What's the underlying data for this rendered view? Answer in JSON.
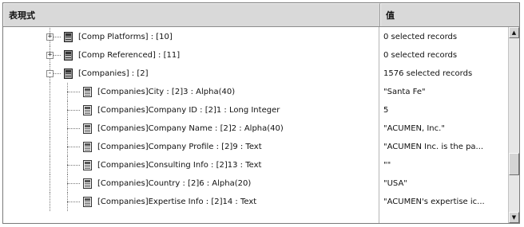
{
  "header": {
    "expression_label": "表現式",
    "value_label": "值"
  },
  "rows": [
    {
      "expander": "+",
      "icon": "table-icon",
      "label": "[Comp Platforms] : [10]",
      "value": "0 selected records"
    },
    {
      "expander": "+",
      "icon": "table-icon",
      "label": "[Comp Referenced] : [11]",
      "value": "0 selected records"
    },
    {
      "expander": "-",
      "icon": "table-icon",
      "label": "[Companies] : [2]",
      "value": "1576 selected records"
    },
    {
      "expander": "",
      "icon": "field-icon",
      "label": "[Companies]City : [2]3 : Alpha(40)",
      "value": "\"Santa Fe\""
    },
    {
      "expander": "",
      "icon": "field-icon",
      "label": "[Companies]Company ID : [2]1 : Long Integer",
      "value": "5"
    },
    {
      "expander": "",
      "icon": "field-icon",
      "label": "[Companies]Company Name : [2]2 : Alpha(40)",
      "value": "\"ACUMEN, Inc.\""
    },
    {
      "expander": "",
      "icon": "field-icon",
      "label": "[Companies]Company Profile : [2]9 : Text",
      "value": "\"ACUMEN Inc. is the pa..."
    },
    {
      "expander": "",
      "icon": "field-icon",
      "label": "[Companies]Consulting Info : [2]13 : Text",
      "value": "\"\""
    },
    {
      "expander": "",
      "icon": "field-icon",
      "label": "[Companies]Country : [2]6 : Alpha(20)",
      "value": "\"USA\""
    },
    {
      "expander": "",
      "icon": "field-icon",
      "label": "[Companies]Expertise Info : [2]14 : Text",
      "value": "\"ACUMEN's expertise ic..."
    }
  ],
  "scrollbar": {
    "up_arrow": "▲",
    "down_arrow": "▼"
  }
}
